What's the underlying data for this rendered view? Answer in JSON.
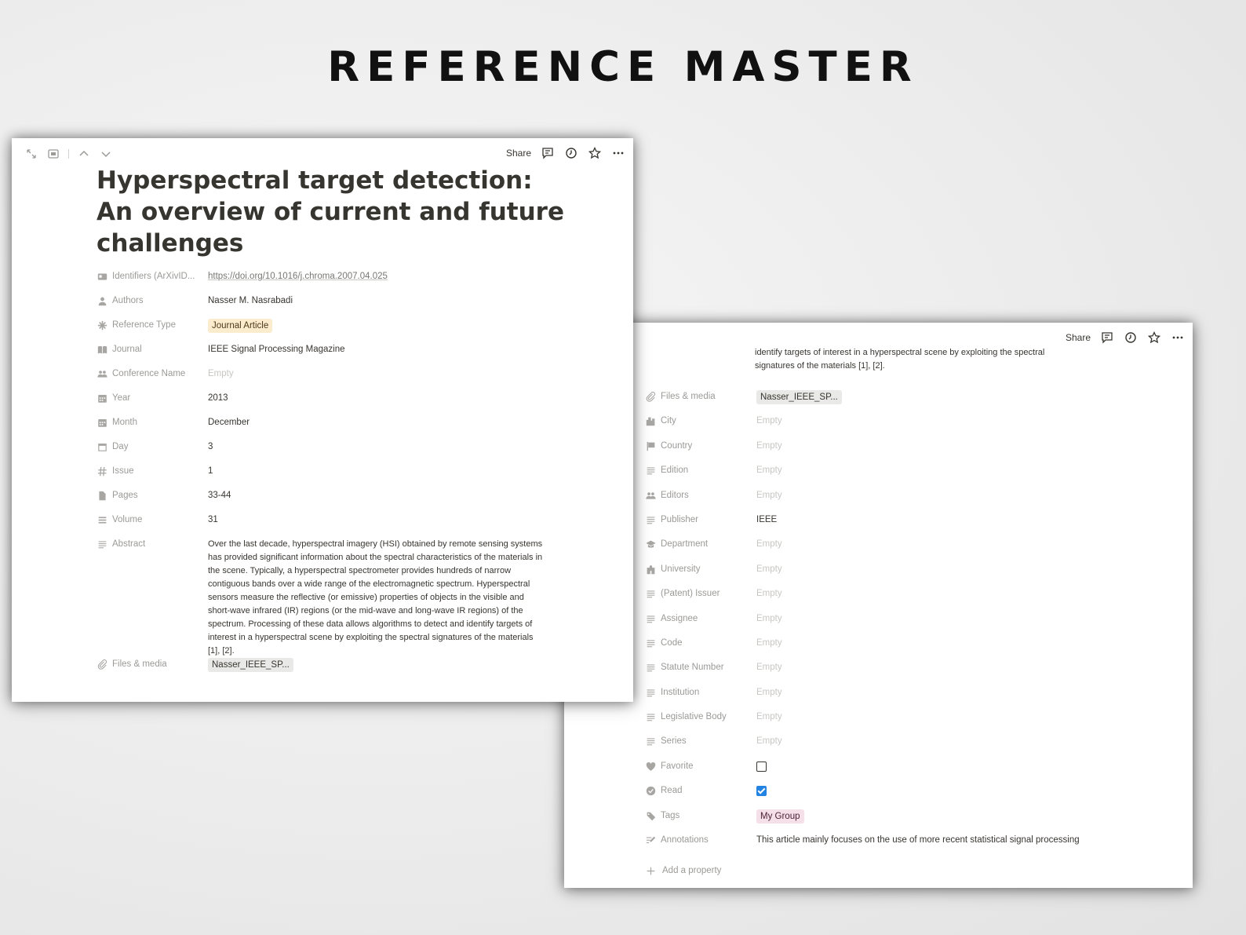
{
  "banner": "REFERENCE MASTER",
  "window1": {
    "topbar": {
      "share": "Share"
    },
    "title": "Hyperspectral target detection: An overview of current and future challenges",
    "properties": [
      {
        "label": "Identifiers (ArXivID...",
        "value": "https://doi.org/10.1016/j.chroma.2007.04.025",
        "kind": "link",
        "icon": "id-card-icon"
      },
      {
        "label": "Authors",
        "value": "Nasser M. Nasrabadi",
        "kind": "text",
        "icon": "person-icon"
      },
      {
        "label": "Reference Type",
        "value": "Journal Article",
        "kind": "tag-orange",
        "icon": "asterisk-icon"
      },
      {
        "label": "Journal",
        "value": "IEEE Signal Processing Magazine",
        "kind": "text",
        "icon": "book-icon"
      },
      {
        "label": "Conference Name",
        "value": "Empty",
        "kind": "empty",
        "icon": "people-icon"
      },
      {
        "label": "Year",
        "value": "2013",
        "kind": "text",
        "icon": "calendar-icon"
      },
      {
        "label": "Month",
        "value": "December",
        "kind": "text",
        "icon": "calendar-icon"
      },
      {
        "label": "Day",
        "value": "3",
        "kind": "text",
        "icon": "calendar-outline-icon"
      },
      {
        "label": "Issue",
        "value": "1",
        "kind": "text",
        "icon": "hash-icon"
      },
      {
        "label": "Pages",
        "value": "33-44",
        "kind": "text",
        "icon": "page-icon"
      },
      {
        "label": "Volume",
        "value": "31",
        "kind": "text",
        "icon": "lines-icon"
      },
      {
        "label": "Abstract",
        "value": "Over the last decade, hyperspectral imagery (HSI) obtained by remote sensing systems has provided significant information about the spectral characteristics of the materials in the scene. Typically, a hyperspectral spectrometer provides hundreds of narrow contiguous bands over a wide range of the electromagnetic spectrum. Hyperspectral sensors measure the reflective (or emissive) properties of objects in the visible and short-wave infrared (IR) regions (or the mid-wave and long-wave IR regions) of the spectrum. Processing of these data allows algorithms to detect and identify targets of interest in a hyperspectral scene by exploiting the spectral signatures of the materials [1], [2].",
        "kind": "abstract",
        "icon": "text-icon"
      },
      {
        "label": "Files & media",
        "value": "Nasser_IEEE_SP...",
        "kind": "tag-gray",
        "icon": "paperclip-icon"
      }
    ]
  },
  "window2": {
    "topbar": {
      "share": "Share"
    },
    "abstract_fragment": "identify targets of interest in a hyperspectral scene by exploiting the spectral signatures of the materials [1], [2].",
    "properties": [
      {
        "label": "Files & media",
        "value": "Nasser_IEEE_SP...",
        "kind": "tag-gray",
        "icon": "paperclip-icon"
      },
      {
        "label": "City",
        "value": "Empty",
        "kind": "empty",
        "icon": "city-icon"
      },
      {
        "label": "Country",
        "value": "Empty",
        "kind": "empty",
        "icon": "flag-icon"
      },
      {
        "label": "Edition",
        "value": "Empty",
        "kind": "empty",
        "icon": "text-icon"
      },
      {
        "label": "Editors",
        "value": "Empty",
        "kind": "empty",
        "icon": "people-icon"
      },
      {
        "label": "Publisher",
        "value": "IEEE",
        "kind": "text",
        "icon": "text-icon"
      },
      {
        "label": "Department",
        "value": "Empty",
        "kind": "empty",
        "icon": "graduation-cap-icon"
      },
      {
        "label": "University",
        "value": "Empty",
        "kind": "empty",
        "icon": "school-icon"
      },
      {
        "label": "(Patent) Issuer",
        "value": "Empty",
        "kind": "empty",
        "icon": "text-icon"
      },
      {
        "label": "Assignee",
        "value": "Empty",
        "kind": "empty",
        "icon": "text-icon"
      },
      {
        "label": "Code",
        "value": "Empty",
        "kind": "empty",
        "icon": "text-icon"
      },
      {
        "label": "Statute Number",
        "value": "Empty",
        "kind": "empty",
        "icon": "text-icon"
      },
      {
        "label": "Institution",
        "value": "Empty",
        "kind": "empty",
        "icon": "text-icon"
      },
      {
        "label": "Legislative Body",
        "value": "Empty",
        "kind": "empty",
        "icon": "text-icon"
      },
      {
        "label": "Series",
        "value": "Empty",
        "kind": "empty",
        "icon": "text-icon"
      },
      {
        "label": "Favorite",
        "value": false,
        "kind": "checkbox",
        "icon": "heart-icon"
      },
      {
        "label": "Read",
        "value": true,
        "kind": "checkbox",
        "icon": "check-circle-icon"
      },
      {
        "label": "Tags",
        "value": "My Group",
        "kind": "tag-pink",
        "icon": "tag-icon"
      },
      {
        "label": "Annotations",
        "value": "This article mainly focuses on the use of more recent statistical signal processing",
        "kind": "annot",
        "icon": "annotation-icon"
      }
    ],
    "add_property": "Add a property"
  },
  "colors": {
    "accent_check": "#2383e2",
    "tag_orange": "#fbeccd",
    "tag_pink": "#f5e0e9",
    "tag_gray": "#e9e9e7"
  }
}
